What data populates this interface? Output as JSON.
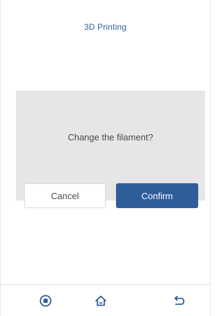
{
  "header": {
    "title": "3D Printing"
  },
  "dialog": {
    "message": "Change the filament?",
    "cancel_label": "Cancel",
    "confirm_label": "Confirm"
  },
  "bottom_nav": {
    "items": [
      {
        "icon": "stop-icon"
      },
      {
        "icon": "home-icon"
      },
      {
        "icon": "back-icon"
      }
    ]
  },
  "colors": {
    "accent": "#2f5d9a",
    "dialog_background": "#e6e6e6",
    "text": "#4a4a4a"
  }
}
